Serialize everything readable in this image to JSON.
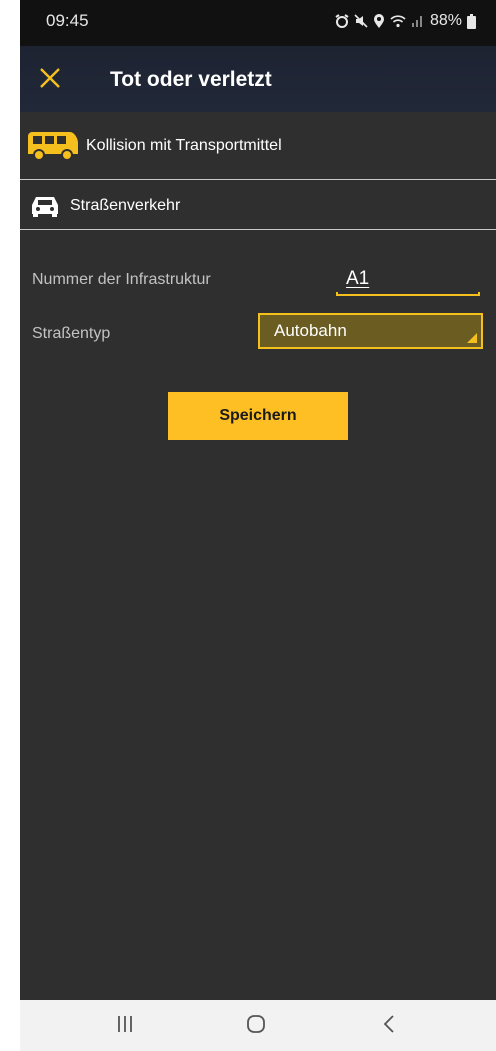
{
  "status_bar": {
    "time": "09:45",
    "battery": "88%",
    "icons": [
      "alarm-icon",
      "mute-icon",
      "location-icon",
      "wifi-icon",
      "signal-icon",
      "battery-icon"
    ]
  },
  "header": {
    "title": "Tot oder verletzt",
    "close_icon": "close-icon"
  },
  "breadcrumbs": [
    {
      "label": "Kollision mit Transportmittel",
      "icon": "bus-icon"
    },
    {
      "label": "Straßenverkehr",
      "icon": "car-icon"
    }
  ],
  "form": {
    "infrastructure": {
      "label": "Nummer der Infrastruktur",
      "value": "A1"
    },
    "road_type": {
      "label": "Straßentyp",
      "value": "Autobahn"
    },
    "save_label": "Speichern"
  },
  "colors": {
    "accent": "#f5bf1e",
    "header_bg": "#1d2331",
    "content_bg": "#2f2f2f"
  },
  "nav_bar": {
    "buttons": [
      "recent-apps-icon",
      "home-icon",
      "back-icon"
    ]
  }
}
